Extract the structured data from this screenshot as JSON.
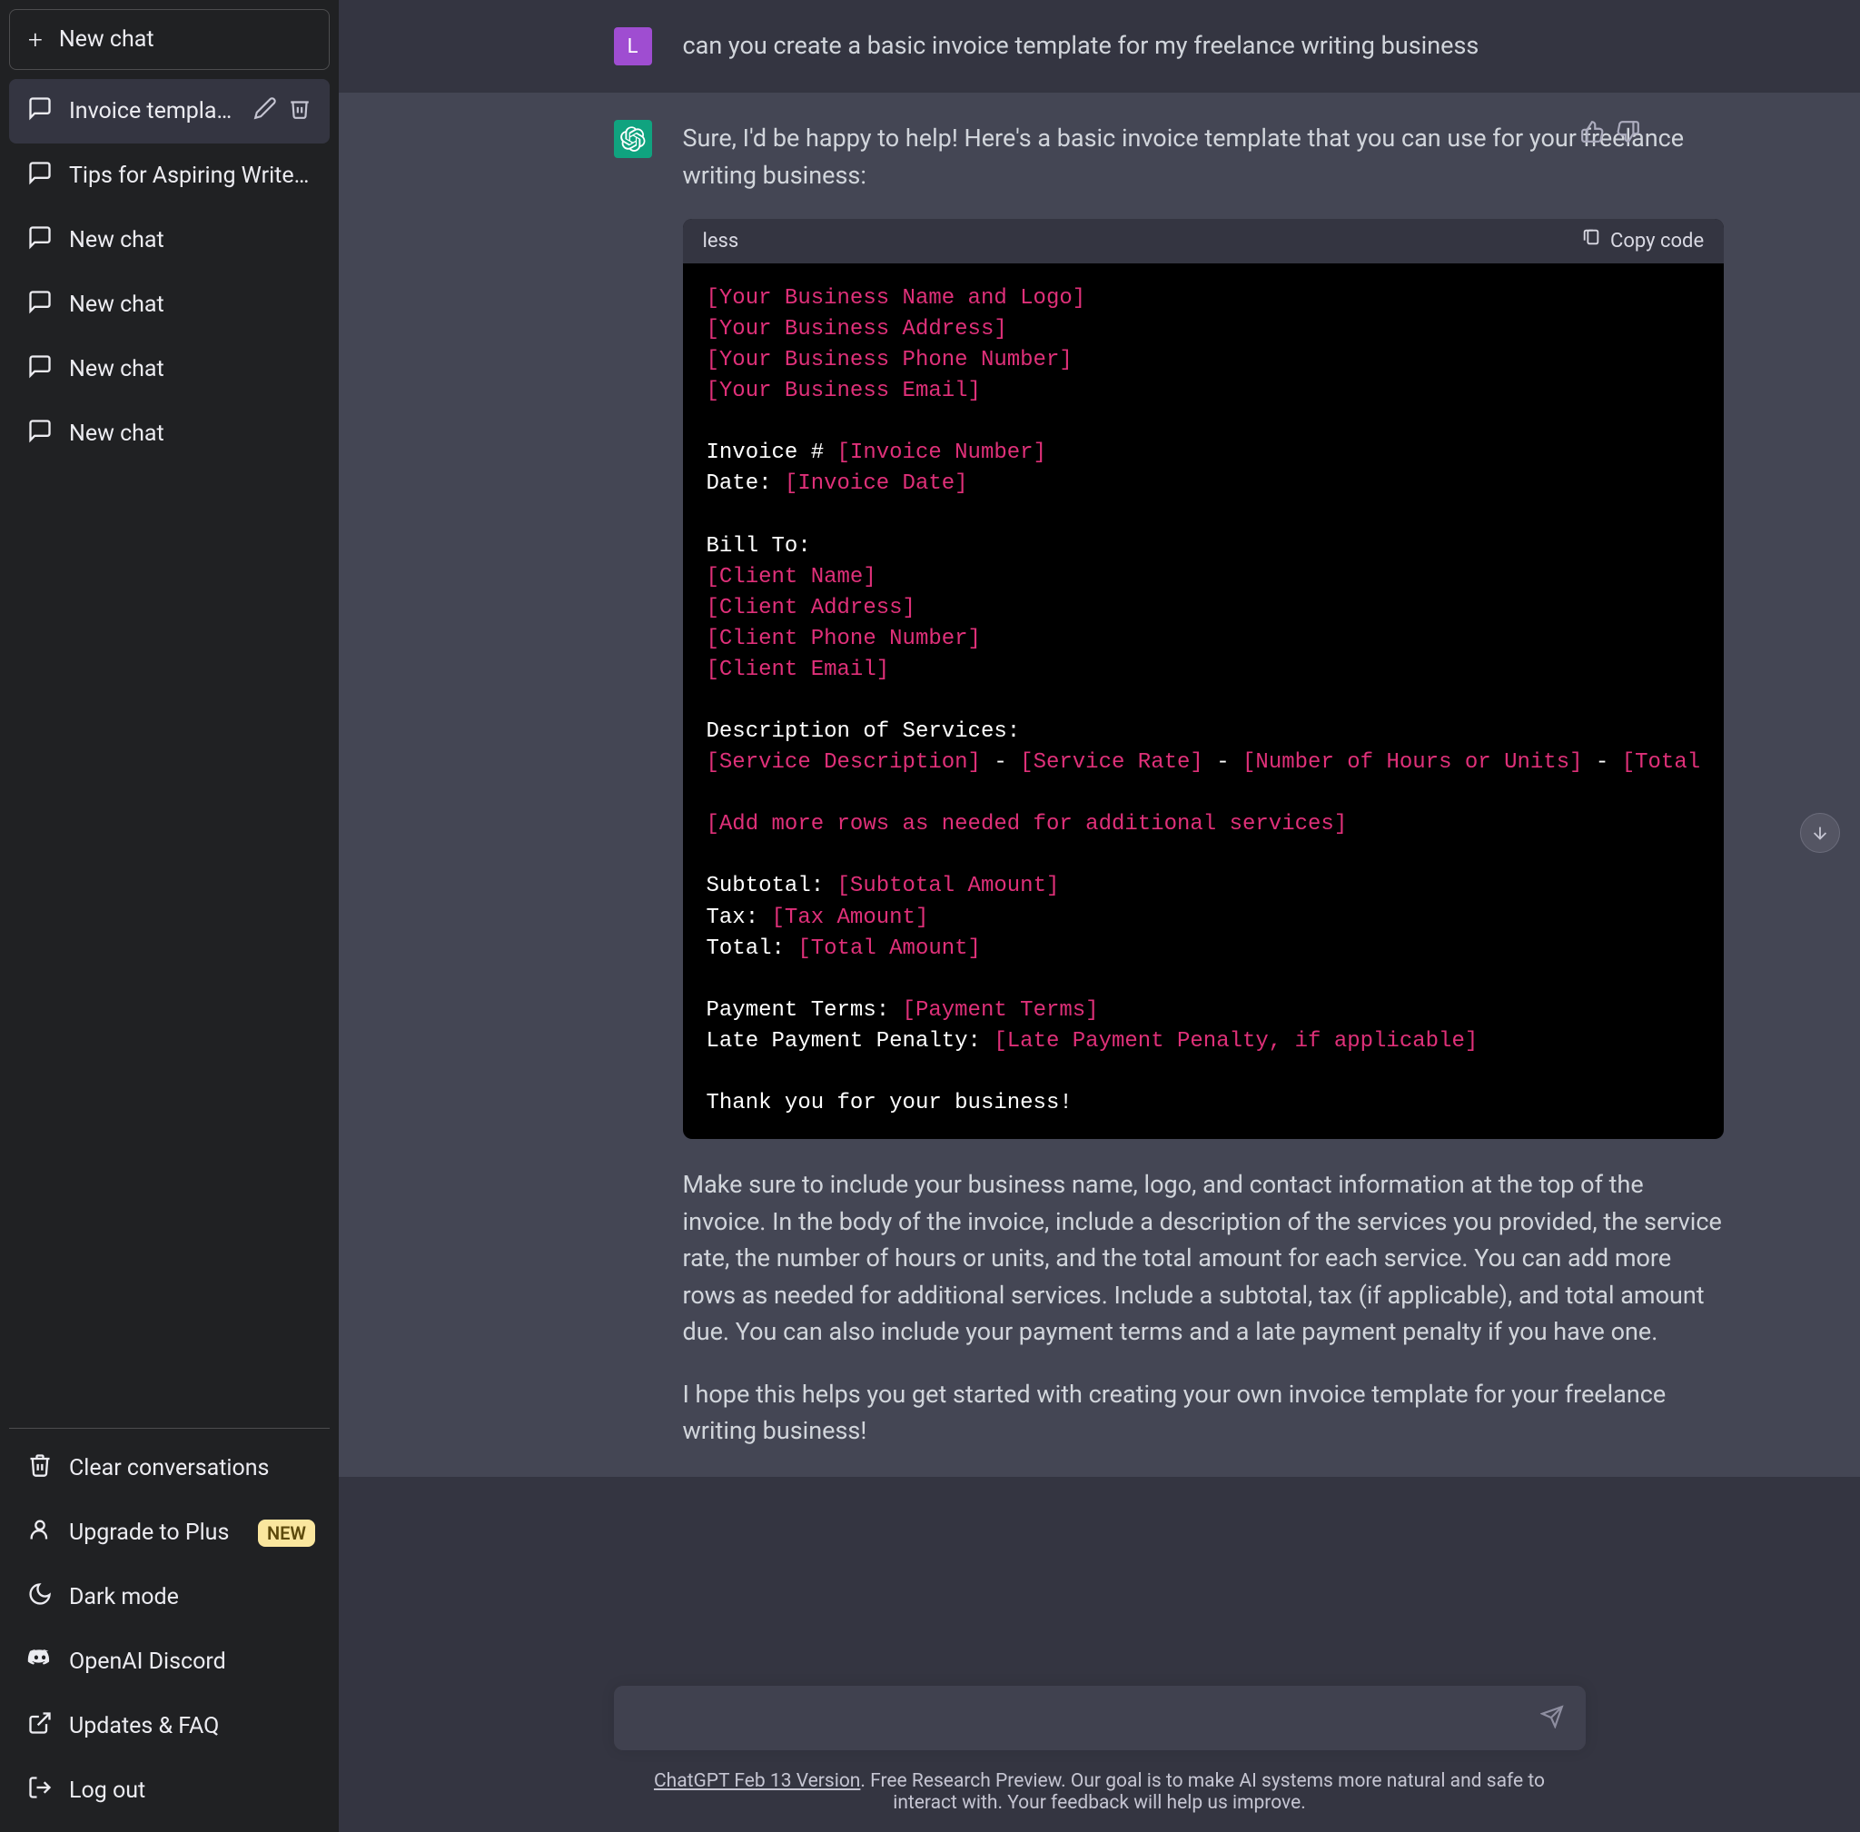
{
  "sidebar": {
    "new_chat": "New chat",
    "items": [
      {
        "title": "Invoice template for fr",
        "active": true
      },
      {
        "title": "Tips for Aspiring Writers",
        "active": false
      },
      {
        "title": "New chat",
        "active": false
      },
      {
        "title": "New chat",
        "active": false
      },
      {
        "title": "New chat",
        "active": false
      },
      {
        "title": "New chat",
        "active": false
      }
    ],
    "footer": {
      "clear": "Clear conversations",
      "upgrade": "Upgrade to Plus",
      "upgrade_badge": "NEW",
      "dark": "Dark mode",
      "discord": "OpenAI Discord",
      "faq": "Updates & FAQ",
      "logout": "Log out"
    }
  },
  "chat": {
    "user_initial": "L",
    "user_message": "can you create a basic invoice template for my freelance writing business",
    "assistant_intro": "Sure, I'd be happy to help! Here's a basic invoice template that you can use for your freelance writing business:",
    "code_lang": "less",
    "copy_label": "Copy code",
    "code_lines": [
      {
        "segments": [
          {
            "t": "[Your Business Name and Logo]",
            "c": "pink"
          }
        ]
      },
      {
        "segments": [
          {
            "t": "[Your Business Address]",
            "c": "pink"
          }
        ]
      },
      {
        "segments": [
          {
            "t": "[Your Business Phone Number]",
            "c": "pink"
          }
        ]
      },
      {
        "segments": [
          {
            "t": "[Your Business Email]",
            "c": "pink"
          }
        ]
      },
      {
        "segments": []
      },
      {
        "segments": [
          {
            "t": "Invoice # ",
            "c": ""
          },
          {
            "t": "[Invoice Number]",
            "c": "pink"
          }
        ]
      },
      {
        "segments": [
          {
            "t": "Date: ",
            "c": ""
          },
          {
            "t": "[Invoice Date]",
            "c": "pink"
          }
        ]
      },
      {
        "segments": []
      },
      {
        "segments": [
          {
            "t": "Bill To:",
            "c": ""
          }
        ]
      },
      {
        "segments": [
          {
            "t": "[Client Name]",
            "c": "pink"
          }
        ]
      },
      {
        "segments": [
          {
            "t": "[Client Address]",
            "c": "pink"
          }
        ]
      },
      {
        "segments": [
          {
            "t": "[Client Phone Number]",
            "c": "pink"
          }
        ]
      },
      {
        "segments": [
          {
            "t": "[Client Email]",
            "c": "pink"
          }
        ]
      },
      {
        "segments": []
      },
      {
        "segments": [
          {
            "t": "Description of Services:",
            "c": ""
          }
        ]
      },
      {
        "segments": [
          {
            "t": "[Service Description]",
            "c": "pink"
          },
          {
            "t": " - ",
            "c": ""
          },
          {
            "t": "[Service Rate]",
            "c": "pink"
          },
          {
            "t": " - ",
            "c": ""
          },
          {
            "t": "[Number of Hours or Units]",
            "c": "pink"
          },
          {
            "t": " - ",
            "c": ""
          },
          {
            "t": "[Total",
            "c": "pink"
          }
        ]
      },
      {
        "segments": []
      },
      {
        "segments": [
          {
            "t": "[Add more rows as needed for additional services]",
            "c": "pink"
          }
        ]
      },
      {
        "segments": []
      },
      {
        "segments": [
          {
            "t": "Subtotal: ",
            "c": ""
          },
          {
            "t": "[Subtotal Amount]",
            "c": "pink"
          }
        ]
      },
      {
        "segments": [
          {
            "t": "Tax: ",
            "c": ""
          },
          {
            "t": "[Tax Amount]",
            "c": "pink"
          }
        ]
      },
      {
        "segments": [
          {
            "t": "Total: ",
            "c": ""
          },
          {
            "t": "[Total Amount]",
            "c": "pink"
          }
        ]
      },
      {
        "segments": []
      },
      {
        "segments": [
          {
            "t": "Payment Terms: ",
            "c": ""
          },
          {
            "t": "[Payment Terms]",
            "c": "pink"
          }
        ]
      },
      {
        "segments": [
          {
            "t": "Late Payment Penalty: ",
            "c": ""
          },
          {
            "t": "[Late Payment Penalty, if applicable]",
            "c": "pink"
          }
        ]
      },
      {
        "segments": []
      },
      {
        "segments": [
          {
            "t": "Thank you for your business!",
            "c": ""
          }
        ]
      }
    ],
    "assistant_p2": "Make sure to include your business name, logo, and contact information at the top of the invoice. In the body of the invoice, include a description of the services you provided, the service rate, the number of hours or units, and the total amount for each service. You can add more rows as needed for additional services. Include a subtotal, tax (if applicable), and total amount due. You can also include your payment terms and a late payment penalty if you have one.",
    "assistant_p3": "I hope this helps you get started with creating your own invoice template for your freelance writing business!"
  },
  "footer": {
    "version_link": "ChatGPT Feb 13 Version",
    "disclaimer_rest": ". Free Research Preview. Our goal is to make AI systems more natural and safe to interact with. Your feedback will help us improve."
  }
}
